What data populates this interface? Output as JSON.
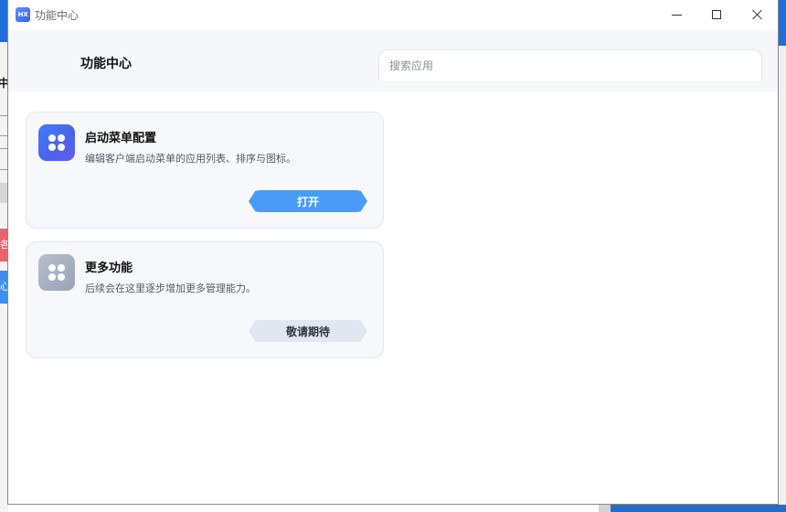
{
  "window": {
    "app_icon_text": "HX",
    "title": "功能中心"
  },
  "header": {
    "page_title": "功能中心",
    "search_placeholder": "搜索应用"
  },
  "cards": [
    {
      "title": "启动菜单配置",
      "description": "编辑客户端启动菜单的应用列表、排序与图标。",
      "button_label": "打开",
      "icon": "apps-grid-icon",
      "icon_color": "#4c63e8"
    },
    {
      "title": "更多功能",
      "description": "后续会在这里逐步增加更多管理能力。",
      "button_label": "敬请期待",
      "icon": "apps-grid-icon",
      "icon_color": "#a9b1c0"
    }
  ],
  "background": {
    "left_chars": [
      "中",
      "各",
      "心"
    ]
  },
  "colors": {
    "accent": "#4a9bf7",
    "header_bg": "#f6f7fa",
    "card_bg": "#f7f8fb"
  }
}
